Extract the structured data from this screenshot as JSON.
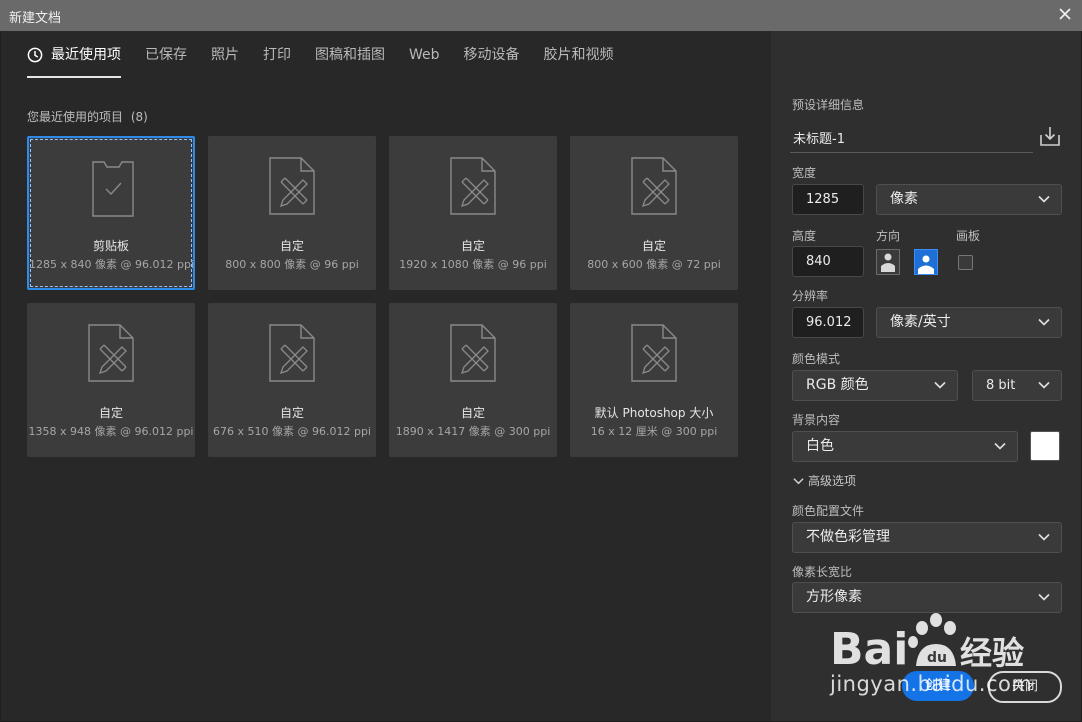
{
  "window": {
    "title": "新建文档"
  },
  "tabs": [
    {
      "label": "最近使用项",
      "active": true
    },
    {
      "label": "已保存"
    },
    {
      "label": "照片"
    },
    {
      "label": "打印"
    },
    {
      "label": "图稿和插图"
    },
    {
      "label": "Web"
    },
    {
      "label": "移动设备"
    },
    {
      "label": "胶片和视频"
    }
  ],
  "recent": {
    "heading": "您最近使用的项目",
    "count": "(8)",
    "items": [
      {
        "name": "剪贴板",
        "meta": "1285 x 840 像素 @ 96.012 ppi",
        "icon": "clipboard-icon",
        "selected": true
      },
      {
        "name": "自定",
        "meta": "800 x 800 像素 @ 96 ppi",
        "icon": "document-pencil-icon"
      },
      {
        "name": "自定",
        "meta": "1920 x 1080 像素 @ 96 ppi",
        "icon": "document-pencil-icon"
      },
      {
        "name": "自定",
        "meta": "800 x 600 像素 @ 72 ppi",
        "icon": "document-pencil-icon"
      },
      {
        "name": "自定",
        "meta": "1358 x 948 像素 @ 96.012 ppi",
        "icon": "document-pencil-icon"
      },
      {
        "name": "自定",
        "meta": "676 x 510 像素 @ 96.012 ppi",
        "icon": "document-pencil-icon"
      },
      {
        "name": "自定",
        "meta": "1890 x 1417 像素 @ 300 ppi",
        "icon": "document-pencil-icon"
      },
      {
        "name": "默认 Photoshop 大小",
        "meta": "16 x 12 厘米 @ 300 ppi",
        "icon": "document-pencil-icon"
      }
    ]
  },
  "preset": {
    "heading": "预设详细信息",
    "doc_name": "未标题-1",
    "width_label": "宽度",
    "width_value": "1285",
    "width_unit": "像素",
    "height_label": "高度",
    "height_value": "840",
    "orientation_label": "方向",
    "artboard_label": "画板",
    "resolution_label": "分辨率",
    "resolution_value": "96.012",
    "resolution_unit": "像素/英寸",
    "color_mode_label": "颜色模式",
    "color_mode_value": "RGB 颜色",
    "bit_depth_value": "8 bit",
    "background_label": "背景内容",
    "background_value": "白色",
    "background_color": "#ffffff",
    "advanced_label": "高级选项",
    "color_profile_label": "颜色配置文件",
    "color_profile_value": "不做色彩管理",
    "pixel_aspect_label": "像素长宽比",
    "pixel_aspect_value": "方形像素"
  },
  "buttons": {
    "create": "创建",
    "close": "关闭"
  },
  "colors": {
    "accent": "#1473e6",
    "selection": "#2d8ceb"
  },
  "watermark": {
    "text": "Bai经验",
    "url": "jingyan.baidu.com"
  }
}
